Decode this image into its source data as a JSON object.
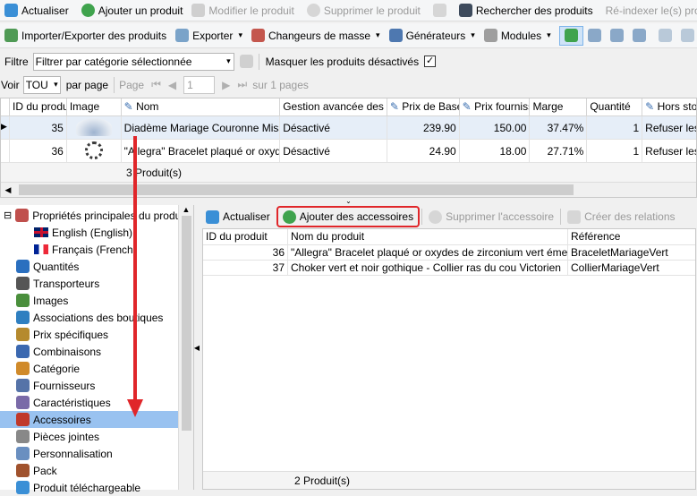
{
  "toolbar1": {
    "refresh": "Actualiser",
    "add": "Ajouter un produit",
    "edit": "Modifier le produit",
    "delete": "Supprimer le produit",
    "search": "Rechercher des produits",
    "reindex": "Ré-indexer le(s) pro"
  },
  "toolbar2": {
    "import_export": "Importer/Exporter des produits",
    "export": "Exporter",
    "mass_change": "Changeurs de masse",
    "generators": "Générateurs",
    "modules": "Modules"
  },
  "filter": {
    "label": "Filtre",
    "value": "Filtrer par catégorie sélectionnée",
    "hide_disabled": "Masquer les produits désactivés"
  },
  "paging": {
    "show": "Voir",
    "per_page_value": "TOU",
    "per_page": "par page",
    "page_label": "Page",
    "page_value": "1",
    "of_pages": "sur 1 pages"
  },
  "products": {
    "columns": [
      "ID du produit",
      "Image",
      "Nom",
      "Gestion avancée des stocks",
      "Prix de Base",
      "Prix fournisseur",
      "Marge",
      "Quantité",
      "Hors stock"
    ],
    "rows": [
      [
        "35",
        "",
        "Diadème Mariage Couronne Miss Arg",
        "Désactivé",
        "239.90",
        "150.00",
        "37.47%",
        "1",
        "Refuser les"
      ],
      [
        "36",
        "",
        "\"Allegra\" Bracelet plaqué or oxydes d",
        "Désactivé",
        "24.90",
        "18.00",
        "27.71%",
        "1",
        "Refuser les"
      ]
    ],
    "footer": "3 Produit(s)"
  },
  "tree": {
    "items": [
      {
        "label": "Propriétés principales du produit",
        "icon": "properties-icon",
        "sub": false
      },
      {
        "label": "English (English)",
        "icon": "uk-flag-icon",
        "sub": true
      },
      {
        "label": "Français (French)",
        "icon": "fr-flag-icon",
        "sub": true
      },
      {
        "label": "Quantités",
        "icon": "123-icon",
        "sub": false
      },
      {
        "label": "Transporteurs",
        "icon": "truck-icon",
        "sub": false
      },
      {
        "label": "Images",
        "icon": "image-icon",
        "sub": false
      },
      {
        "label": "Associations des boutiques",
        "icon": "globe-icon",
        "sub": false
      },
      {
        "label": "Prix spécifiques",
        "icon": "price-icon",
        "sub": false
      },
      {
        "label": "Combinaisons",
        "icon": "combination-icon",
        "sub": false
      },
      {
        "label": "Catégorie",
        "icon": "category-icon",
        "sub": false
      },
      {
        "label": "Fournisseurs",
        "icon": "supplier-icon",
        "sub": false
      },
      {
        "label": "Caractéristiques",
        "icon": "features-icon",
        "sub": false
      },
      {
        "label": "Accessoires",
        "icon": "accessories-icon",
        "sub": false,
        "active": true
      },
      {
        "label": "Pièces jointes",
        "icon": "attachment-icon",
        "sub": false
      },
      {
        "label": "Personnalisation",
        "icon": "customization-icon",
        "sub": false
      },
      {
        "label": "Pack",
        "icon": "pack-icon",
        "sub": false
      },
      {
        "label": "Produit téléchargeable",
        "icon": "download-icon",
        "sub": false
      }
    ]
  },
  "accessories": {
    "refresh": "Actualiser",
    "add": "Ajouter des accessoires",
    "remove": "Supprimer l'accessoire",
    "relations": "Créer des relations",
    "columns": [
      "ID du produit",
      "Nom du produit",
      "Référence"
    ],
    "rows": [
      [
        "36",
        "\"Allegra\" Bracelet plaqué or oxydes de zirconium vert émeraude",
        "BraceletMariageVert"
      ],
      [
        "37",
        "Choker vert et noir gothique - Collier ras du cou Victorien",
        "CollierMariageVert"
      ]
    ],
    "footer": "2 Produit(s)"
  },
  "colors": {
    "highlight_box": "#e0262a",
    "arrow": "#e0262a",
    "active_item": "#99c2f0"
  }
}
